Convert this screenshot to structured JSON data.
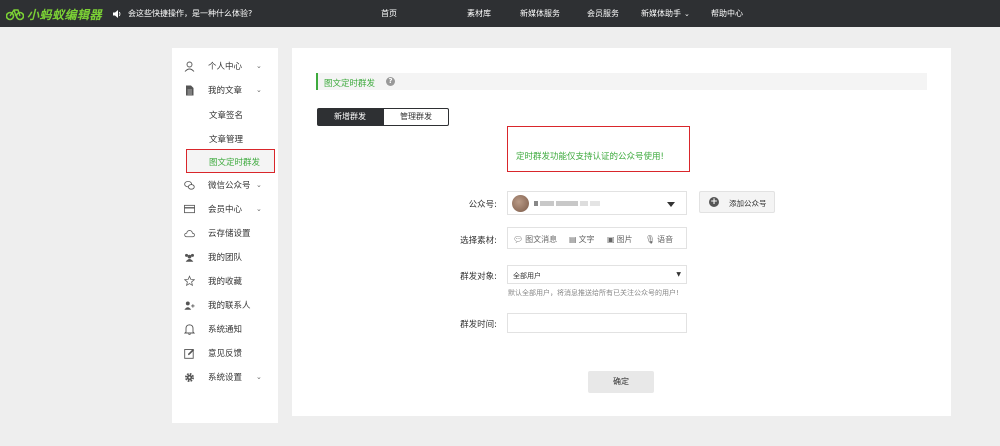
{
  "topbar": {
    "logo_text": "小蚂蚁编辑器",
    "notice": "会这些快捷操作，是一种什么体验?",
    "nav": [
      {
        "label": "首页"
      },
      {
        "label": "素材库"
      },
      {
        "label": "新媒体服务"
      },
      {
        "label": "会员服务"
      },
      {
        "label": "新媒体助手"
      },
      {
        "label": "帮助中心"
      }
    ]
  },
  "sidebar": {
    "items": [
      {
        "label": "个人中心",
        "icon": "user-icon"
      },
      {
        "label": "我的文章",
        "icon": "document-icon"
      },
      {
        "label": "文章签名"
      },
      {
        "label": "文章管理"
      },
      {
        "label": "图文定时群发"
      },
      {
        "label": "微信公众号",
        "icon": "wechat-icon"
      },
      {
        "label": "会员中心",
        "icon": "card-icon"
      },
      {
        "label": "云存储设置",
        "icon": "cloud-icon"
      },
      {
        "label": "我的团队",
        "icon": "team-icon"
      },
      {
        "label": "我的收藏",
        "icon": "star-icon"
      },
      {
        "label": "我的联系人",
        "icon": "add-contact-icon"
      },
      {
        "label": "系统通知",
        "icon": "bell-icon"
      },
      {
        "label": "意见反馈",
        "icon": "edit-icon"
      },
      {
        "label": "系统设置",
        "icon": "gear-icon"
      }
    ]
  },
  "main": {
    "title": "图文定时群发",
    "help_icon": "?",
    "tabs": [
      {
        "label": "新增群发"
      },
      {
        "label": "管理群发"
      }
    ],
    "alert": "定时群发功能仅支持认证的公众号使用!",
    "form": {
      "account_label": "公众号:",
      "add_account": "添加公众号",
      "material_label": "选择素材:",
      "materials": [
        {
          "label": "图文消息",
          "icon": "chat-icon"
        },
        {
          "label": "文字",
          "icon": "text-icon"
        },
        {
          "label": "图片",
          "icon": "image-icon"
        },
        {
          "label": "语音",
          "icon": "mic-icon"
        }
      ],
      "target_label": "群发对象:",
      "target_value": "全部用户",
      "target_hint": "默认全部用户，将消息推送给所有已关注公众号的用户!",
      "time_label": "群发时间:",
      "time_value": ""
    },
    "confirm": "确定"
  },
  "colors": {
    "topbar_bg": "#2e3033",
    "accent_green": "#3daa3d",
    "alert_red": "#d9262b",
    "page_bg": "#eeeeee"
  }
}
